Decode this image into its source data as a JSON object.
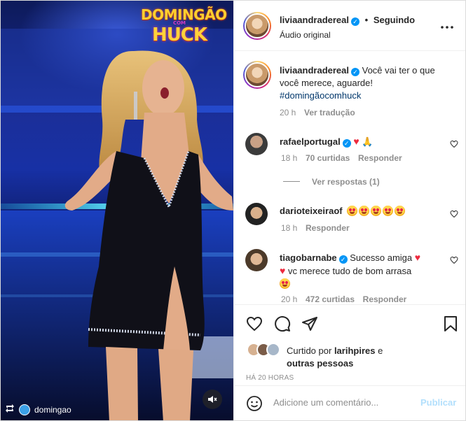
{
  "media": {
    "logo_line1": "DOMINGÃO",
    "logo_line2": "COM",
    "logo_line3": "HUCK",
    "repost_icon": "repost-icon",
    "repost_account": "domingao",
    "mute_icon": "speaker-muted-icon"
  },
  "header": {
    "username": "liviaandradereal",
    "verified_icon": "verified-badge-icon",
    "separator": "•",
    "follow_status": "Seguindo",
    "audio": "Áudio original",
    "more_icon": "more-options-icon"
  },
  "caption": {
    "username": "liviaandradereal",
    "text": "Você vai ter o que você merece, aguarde!",
    "hashtag": "#domingãocomhuck",
    "time": "20 h",
    "translate": "Ver tradução"
  },
  "comments": [
    {
      "username": "rafaelportugal",
      "verified": true,
      "text_icons": [
        "red-heart-emoji",
        "praying-hands-emoji"
      ],
      "time": "18 h",
      "likes": "70 curtidas",
      "reply": "Responder",
      "view_replies": "Ver respostas (1)"
    },
    {
      "username": "darioteixeiraof",
      "verified": false,
      "text_icons": [
        "heart-eyes-emoji",
        "heart-eyes-emoji",
        "heart-eyes-emoji",
        "heart-eyes-emoji",
        "heart-eyes-emoji"
      ],
      "time": "18 h",
      "reply": "Responder"
    },
    {
      "username": "tiagobarnabe",
      "verified": true,
      "text_part1": "Sucesso amiga",
      "text_part2": "vc merece tudo de bom arrasa",
      "time": "20 h",
      "likes": "472 curtidas",
      "reply": "Responder"
    }
  ],
  "actions": {
    "like_icon": "heart-outline-icon",
    "comment_icon": "comment-icon",
    "share_icon": "share-paper-plane-icon",
    "save_icon": "bookmark-icon",
    "liked_by_prefix": "Curtido por",
    "liked_by_user": "larihpires",
    "liked_by_and": "e",
    "liked_by_others": "outras pessoas",
    "timestamp": "HÁ 20 HORAS"
  },
  "add_comment": {
    "emoji_icon": "emoji-smiley-icon",
    "placeholder": "Adicione um comentário...",
    "publish": "Publicar"
  },
  "colors": {
    "accent_blue": "#0095f6",
    "publish_disabled": "#b2dffc",
    "like_red": "#ed2a3e",
    "text_primary": "#262626",
    "text_secondary": "#8e8e8e"
  }
}
